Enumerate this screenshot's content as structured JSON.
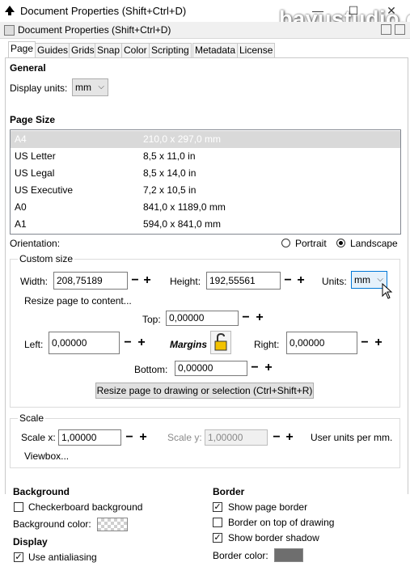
{
  "window": {
    "title": "Document Properties (Shift+Ctrl+D)",
    "watermark": "bayustudio.c",
    "minimize_glyph": "—",
    "maximize_glyph": "☐",
    "close_glyph": "✕"
  },
  "dock": {
    "title": "Document Properties (Shift+Ctrl+D)"
  },
  "tabs": [
    "Page",
    "Guides",
    "Grids",
    "Snap",
    "Color",
    "Scripting",
    "Metadata",
    "License"
  ],
  "general": {
    "heading": "General",
    "display_units_label": "Display units:",
    "display_units_value": "mm"
  },
  "page_size": {
    "heading": "Page Size",
    "rows": [
      {
        "name": "A4",
        "size": "210,0 x 297,0 mm",
        "selected": true
      },
      {
        "name": "US Letter",
        "size": "8,5 x 11,0 in"
      },
      {
        "name": "US Legal",
        "size": "8,5 x 14,0 in"
      },
      {
        "name": "US Executive",
        "size": "7,2 x 10,5 in"
      },
      {
        "name": "A0",
        "size": "841,0 x 1189,0 mm"
      },
      {
        "name": "A1",
        "size": "594,0 x 841,0 mm"
      }
    ]
  },
  "orientation": {
    "label": "Orientation:",
    "portrait": "Portrait",
    "landscape": "Landscape",
    "selected": "Landscape"
  },
  "custom_size": {
    "legend": "Custom size",
    "width_label": "Width:",
    "width_value": "208,75189",
    "height_label": "Height:",
    "height_value": "192,55561",
    "units_label": "Units:",
    "units_value": "mm",
    "resize_link": "Resize page to content...",
    "top_label": "Top:",
    "top_value": "0,00000",
    "left_label": "Left:",
    "left_value": "0,00000",
    "margins_label": "Margins",
    "right_label": "Right:",
    "right_value": "0,00000",
    "bottom_label": "Bottom:",
    "bottom_value": "0,00000",
    "resize_button": "Resize page to drawing or selection (Ctrl+Shift+R)"
  },
  "scale": {
    "legend": "Scale",
    "scale_x_label": "Scale x:",
    "scale_x_value": "1,00000",
    "scale_y_label": "Scale y:",
    "scale_y_value": "1,00000",
    "units_text": "User units per mm.",
    "viewbox_link": "Viewbox..."
  },
  "background": {
    "heading": "Background",
    "checkerboard_label": "Checkerboard background",
    "checkerboard_checked": false,
    "color_label": "Background color:"
  },
  "display": {
    "heading": "Display",
    "antialias_label": "Use antialiasing",
    "antialias_checked": true
  },
  "border": {
    "heading": "Border",
    "show_border_label": "Show page border",
    "show_border_checked": true,
    "on_top_label": "Border on top of drawing",
    "on_top_checked": false,
    "shadow_label": "Show border shadow",
    "shadow_checked": true,
    "color_label": "Border color:",
    "color": "#6e6e6e"
  },
  "glyphs": {
    "minus": "−",
    "plus": "+",
    "chevron": "⌵",
    "check": "✓"
  }
}
